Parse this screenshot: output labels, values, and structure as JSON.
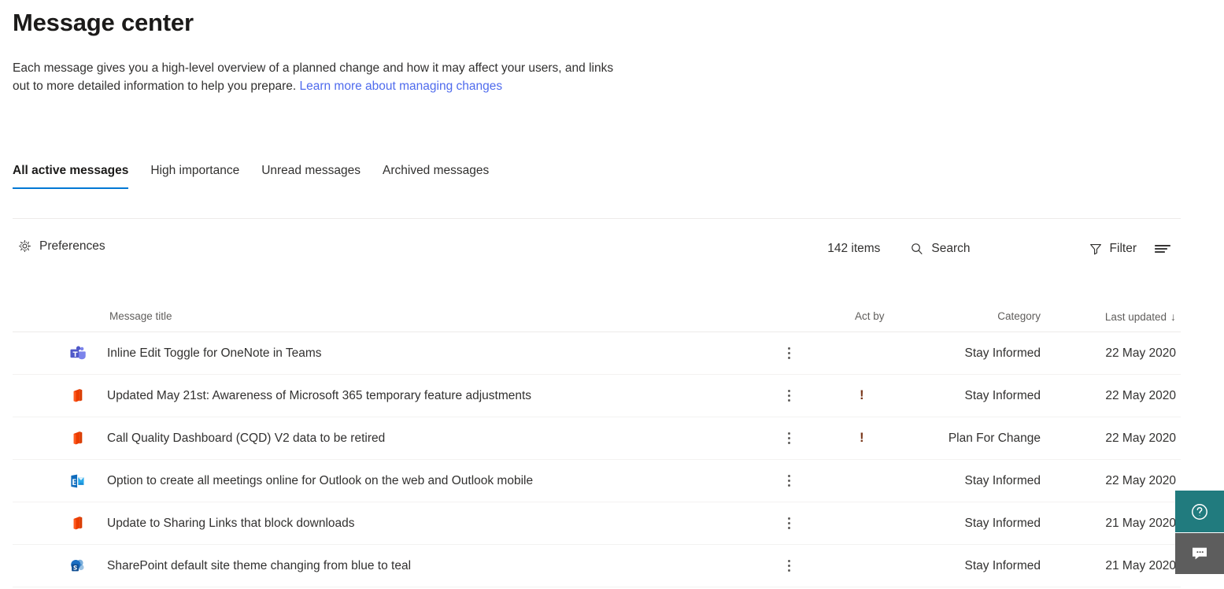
{
  "page": {
    "title": "Message center",
    "intro_text_before_link": "Each message gives you a high-level overview of a planned change and how it may affect your users, and links out to more detailed information to help you prepare. ",
    "intro_link_text": "Learn more about managing changes"
  },
  "tabs": [
    {
      "label": "All active messages",
      "active": true
    },
    {
      "label": "High importance",
      "active": false
    },
    {
      "label": "Unread messages",
      "active": false
    },
    {
      "label": "Archived messages",
      "active": false
    }
  ],
  "commandbar": {
    "preferences_label": "Preferences",
    "preferences_icon": "gear-icon",
    "item_count": "142 items",
    "search_label": "Search",
    "search_icon": "search-icon",
    "filter_label": "Filter",
    "filter_icon": "filter-funnel-icon",
    "group_icon": "group-list-icon"
  },
  "table": {
    "columns": {
      "title": "Message title",
      "act_by": "Act by",
      "category": "Category",
      "last_updated": "Last updated",
      "sort_indicator": "↓"
    },
    "rows": [
      {
        "app_icon": "microsoft-teams-icon",
        "title": "Inline Edit Toggle for OneNote in Teams",
        "act_by": "",
        "high_importance": "",
        "category": "Stay Informed",
        "last_updated": "22 May 2020",
        "more_icon": "more-vertical-icon"
      },
      {
        "app_icon": "office-365-icon",
        "title": "Updated May 21st: Awareness of Microsoft 365 temporary feature adjustments",
        "act_by": "",
        "high_importance": "!",
        "category": "Stay Informed",
        "last_updated": "22 May 2020",
        "more_icon": "more-vertical-icon"
      },
      {
        "app_icon": "office-365-icon",
        "title": "Call Quality Dashboard (CQD) V2 data to be retired",
        "act_by": "",
        "high_importance": "!",
        "category": "Plan For Change",
        "last_updated": "22 May 2020",
        "more_icon": "more-vertical-icon"
      },
      {
        "app_icon": "exchange-icon",
        "title": "Option to create all meetings online for Outlook on the web and Outlook mobile",
        "act_by": "",
        "high_importance": "",
        "category": "Stay Informed",
        "last_updated": "22 May 2020",
        "more_icon": "more-vertical-icon"
      },
      {
        "app_icon": "office-365-icon",
        "title": "Update to Sharing Links that block downloads",
        "act_by": "",
        "high_importance": "",
        "category": "Stay Informed",
        "last_updated": "21 May 2020",
        "more_icon": "more-vertical-icon"
      },
      {
        "app_icon": "sharepoint-icon",
        "title": "SharePoint default site theme changing from blue to teal",
        "act_by": "",
        "high_importance": "",
        "category": "Stay Informed",
        "last_updated": "21 May 2020",
        "more_icon": "more-vertical-icon"
      }
    ]
  },
  "floating": {
    "help_icon": "help-question-circle-icon",
    "feedback_icon": "feedback-speech-bubble-icon"
  },
  "colors": {
    "accent_blue": "#0078d4",
    "link_blue": "#4f6bed",
    "high_importance": "#7b3a1e",
    "help_teal": "#217b7e",
    "feedback_gray": "#5d5d5d",
    "teams_purple": "#6264a7",
    "office_orange": "#eb3c00",
    "exchange_blue": "#0f6cbd",
    "sharepoint_blue": "#0f6cbd"
  }
}
